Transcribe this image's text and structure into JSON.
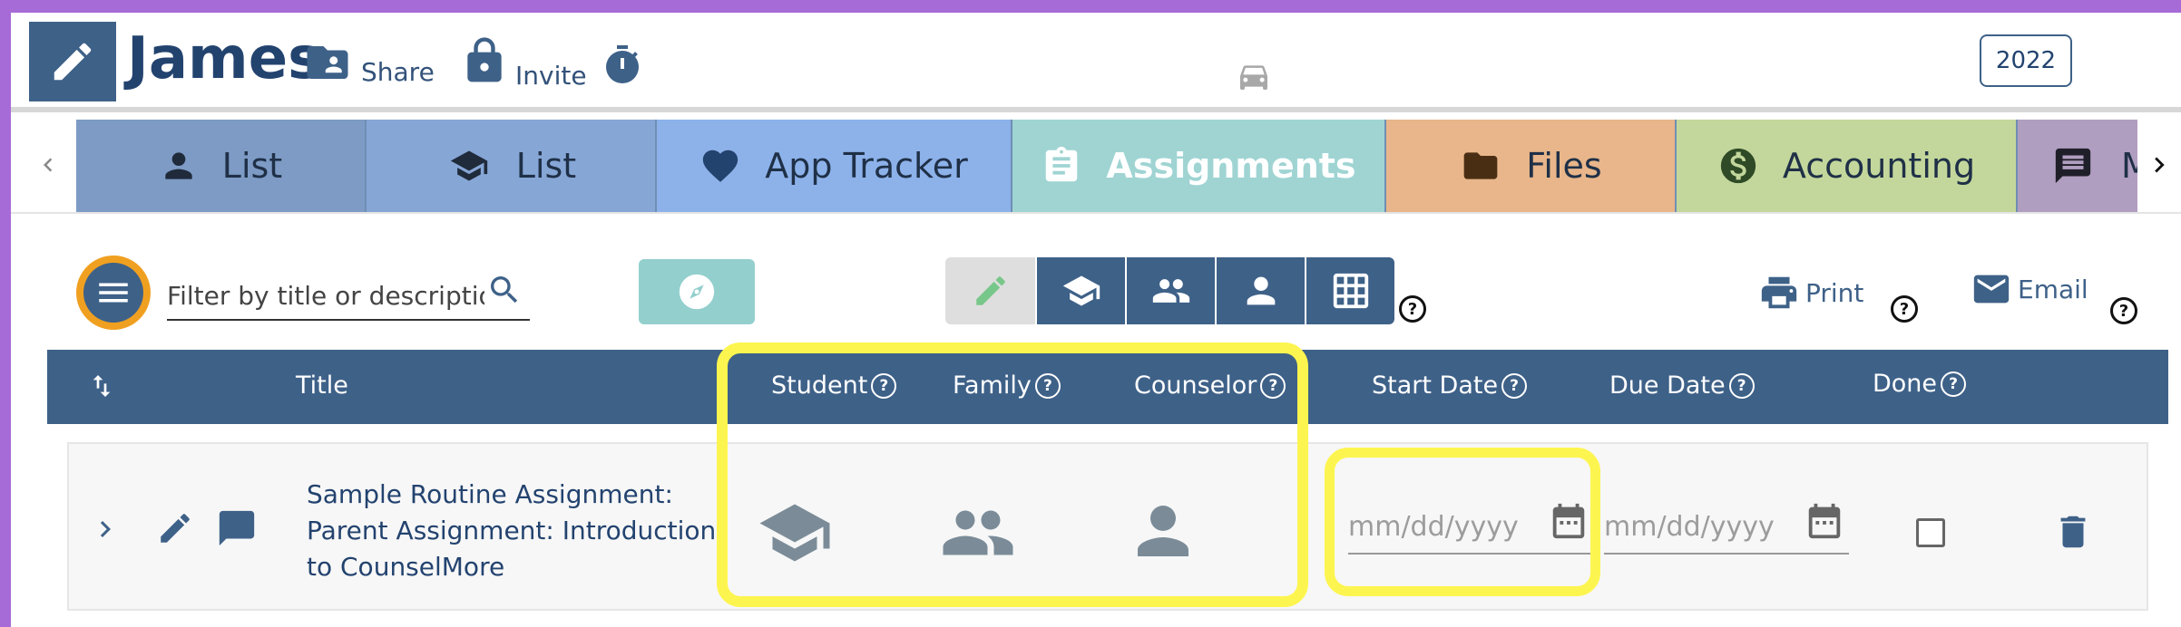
{
  "header": {
    "name": "James",
    "share_label": "Share",
    "invite_label": "Invite",
    "year": "2022"
  },
  "tabs": [
    {
      "label": "List",
      "icon": "person-icon",
      "color": "#7d9bc4"
    },
    {
      "label": "List",
      "icon": "graduation-cap-icon",
      "color": "#86a6d6"
    },
    {
      "label": "App Tracker",
      "icon": "heart-icon",
      "color": "#8db2ea"
    },
    {
      "label": "Assignments",
      "icon": "clipboard-icon",
      "color": "#9fd4d3"
    },
    {
      "label": "Files",
      "icon": "folder-icon",
      "color": "#e8b68a"
    },
    {
      "label": "Accounting",
      "icon": "dollar-icon",
      "color": "#c3d79c"
    },
    {
      "label": "M",
      "icon": "message-icon",
      "color": "#b09ec0"
    }
  ],
  "toolbar": {
    "filter_placeholder": "Filter by title or description",
    "print_label": "Print",
    "email_label": "Email"
  },
  "table": {
    "columns": {
      "title": "Title",
      "student": "Student",
      "family": "Family",
      "counselor": "Counselor",
      "start_date": "Start Date",
      "due_date": "Due Date",
      "done": "Done"
    },
    "rows": [
      {
        "title": "Sample Routine Assignment: Parent Assignment: Introduction to CounselMore",
        "start_date_placeholder": "mm/dd/yyyy",
        "due_date_placeholder": "mm/dd/yyyy"
      }
    ]
  },
  "colors": {
    "primary": "#3e6188",
    "highlight": "#fdf54f",
    "frame": "#a76bd8",
    "fab_ring": "#f0a020"
  }
}
